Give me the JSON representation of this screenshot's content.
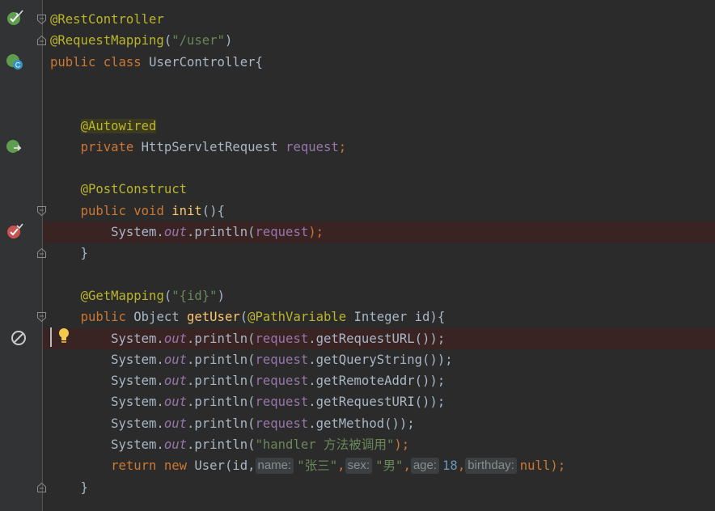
{
  "editor": {
    "language": "java",
    "lines": [
      {
        "tokens": [
          {
            "t": "@RestController",
            "c": "ann"
          }
        ]
      },
      {
        "tokens": [
          {
            "t": "@RequestMapping",
            "c": "ann"
          },
          {
            "t": "(",
            "c": "plain"
          },
          {
            "t": "\"/user\"",
            "c": "str"
          },
          {
            "t": ")",
            "c": "plain"
          }
        ]
      },
      {
        "tokens": [
          {
            "t": "public class ",
            "c": "kw"
          },
          {
            "t": "UserController{",
            "c": "plain"
          }
        ]
      },
      {
        "tokens": []
      },
      {
        "tokens": []
      },
      {
        "tokens": [
          {
            "t": "    ",
            "c": "plain"
          },
          {
            "t": "@Autowired",
            "c": "ann ann-hl"
          }
        ]
      },
      {
        "tokens": [
          {
            "t": "    ",
            "c": "plain"
          },
          {
            "t": "private ",
            "c": "kw"
          },
          {
            "t": "HttpServletRequest ",
            "c": "plain"
          },
          {
            "t": "request",
            "c": "fld"
          },
          {
            "t": ";",
            "c": "kw"
          }
        ]
      },
      {
        "tokens": []
      },
      {
        "tokens": [
          {
            "t": "    ",
            "c": "plain"
          },
          {
            "t": "@PostConstruct",
            "c": "ann"
          }
        ]
      },
      {
        "tokens": [
          {
            "t": "    ",
            "c": "plain"
          },
          {
            "t": "public void ",
            "c": "kw"
          },
          {
            "t": "init",
            "c": "fn"
          },
          {
            "t": "(){",
            "c": "plain"
          }
        ]
      },
      {
        "tokens": [
          {
            "t": "        System.",
            "c": "plain"
          },
          {
            "t": "out",
            "c": "static"
          },
          {
            "t": ".println(",
            "c": "plain"
          },
          {
            "t": "request",
            "c": "fld"
          },
          {
            "t": ");",
            "c": "kw"
          }
        ]
      },
      {
        "tokens": [
          {
            "t": "    }",
            "c": "plain"
          }
        ]
      },
      {
        "tokens": []
      },
      {
        "tokens": [
          {
            "t": "    ",
            "c": "plain"
          },
          {
            "t": "@GetMapping",
            "c": "ann"
          },
          {
            "t": "(",
            "c": "plain"
          },
          {
            "t": "\"{id}\"",
            "c": "str"
          },
          {
            "t": ")",
            "c": "plain"
          }
        ]
      },
      {
        "tokens": [
          {
            "t": "    ",
            "c": "plain"
          },
          {
            "t": "public ",
            "c": "kw"
          },
          {
            "t": "Object ",
            "c": "plain"
          },
          {
            "t": "getUser",
            "c": "fn"
          },
          {
            "t": "(",
            "c": "plain"
          },
          {
            "t": "@PathVariable ",
            "c": "ann"
          },
          {
            "t": "Integer id){",
            "c": "plain"
          }
        ]
      },
      {
        "tokens": [
          {
            "t": "        System.",
            "c": "plain"
          },
          {
            "t": "out",
            "c": "static"
          },
          {
            "t": ".println(",
            "c": "plain"
          },
          {
            "t": "request",
            "c": "fld"
          },
          {
            "t": ".getRequestURL());",
            "c": "plain"
          }
        ]
      },
      {
        "tokens": [
          {
            "t": "        System.",
            "c": "plain"
          },
          {
            "t": "out",
            "c": "static"
          },
          {
            "t": ".println(",
            "c": "plain"
          },
          {
            "t": "request",
            "c": "fld"
          },
          {
            "t": ".getQueryString());",
            "c": "plain"
          }
        ]
      },
      {
        "tokens": [
          {
            "t": "        System.",
            "c": "plain"
          },
          {
            "t": "out",
            "c": "static"
          },
          {
            "t": ".println(",
            "c": "plain"
          },
          {
            "t": "request",
            "c": "fld"
          },
          {
            "t": ".getRemoteAddr());",
            "c": "plain"
          }
        ]
      },
      {
        "tokens": [
          {
            "t": "        System.",
            "c": "plain"
          },
          {
            "t": "out",
            "c": "static"
          },
          {
            "t": ".println(",
            "c": "plain"
          },
          {
            "t": "request",
            "c": "fld"
          },
          {
            "t": ".getRequestURI());",
            "c": "plain"
          }
        ]
      },
      {
        "tokens": [
          {
            "t": "        System.",
            "c": "plain"
          },
          {
            "t": "out",
            "c": "static"
          },
          {
            "t": ".println(",
            "c": "plain"
          },
          {
            "t": "request",
            "c": "fld"
          },
          {
            "t": ".getMethod());",
            "c": "plain"
          }
        ]
      },
      {
        "tokens": [
          {
            "t": "        System.",
            "c": "plain"
          },
          {
            "t": "out",
            "c": "static"
          },
          {
            "t": ".println(",
            "c": "plain"
          },
          {
            "t": "\"handler 方法被调用\"",
            "c": "str"
          },
          {
            "t": ");",
            "c": "kw"
          }
        ]
      },
      {
        "tokens": [
          {
            "t": "        ",
            "c": "plain"
          },
          {
            "t": "return new ",
            "c": "kw"
          },
          {
            "t": "User(id,",
            "c": "plain"
          },
          {
            "t": "name:",
            "c": "hint"
          },
          {
            "t": "\"张三\"",
            "c": "str"
          },
          {
            "t": ",",
            "c": "kw"
          },
          {
            "t": "sex:",
            "c": "hint"
          },
          {
            "t": "\"男\"",
            "c": "str"
          },
          {
            "t": ",",
            "c": "kw"
          },
          {
            "t": "age:",
            "c": "hint"
          },
          {
            "t": "18",
            "c": "num"
          },
          {
            "t": ",",
            "c": "kw"
          },
          {
            "t": "birthday:",
            "c": "hint"
          },
          {
            "t": "null",
            "c": "kw"
          },
          {
            "t": ");",
            "c": "kw"
          }
        ]
      },
      {
        "tokens": [
          {
            "t": "    }",
            "c": "plain"
          }
        ]
      }
    ]
  },
  "gutter": {
    "icons": [
      {
        "line": 1,
        "icon": "spring-bean-check-icon"
      },
      {
        "line": 3,
        "icon": "spring-controller-class-icon"
      },
      {
        "line": 7,
        "icon": "autowired-navigate-icon"
      },
      {
        "line": 11,
        "icon": "breakpoint-check-icon"
      },
      {
        "line": 16,
        "icon": "muted-breakpoint-icon"
      }
    ],
    "folds": [
      {
        "line": 1,
        "kind": "start"
      },
      {
        "line": 2,
        "kind": "end"
      },
      {
        "line": 10,
        "kind": "start"
      },
      {
        "line": 12,
        "kind": "end"
      },
      {
        "line": 15,
        "kind": "start"
      },
      {
        "line": 23,
        "kind": "end"
      }
    ]
  },
  "highlights": {
    "breakpoint_line": 11,
    "current_line": 16
  },
  "colors": {
    "background": "#2b2b2b",
    "gutter": "#313335",
    "annotation": "#bbb529",
    "string": "#6a8759",
    "keyword": "#cc7832",
    "method": "#ffc66d",
    "field": "#9876aa",
    "number": "#6897bb",
    "text": "#a9b7c6"
  }
}
